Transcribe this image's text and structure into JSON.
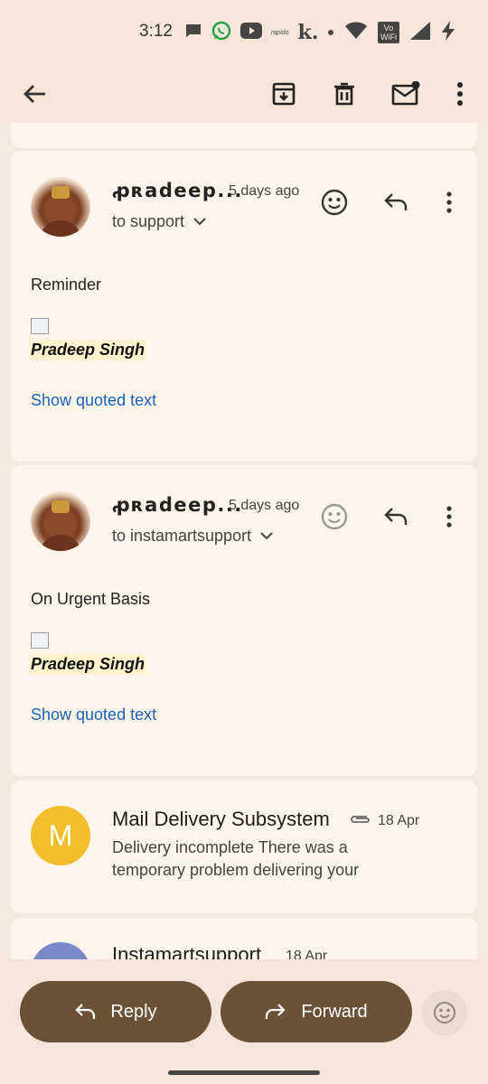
{
  "status_bar": {
    "time": "3:12",
    "icons": [
      "message-icon",
      "whatsapp-icon",
      "youtube-icon",
      "rapido-icon",
      "k-app-icon",
      "dot-icon",
      "wifi-icon",
      "vowifi-icon",
      "signal-icon",
      "charging-icon"
    ],
    "rapido_text": "rapido",
    "k_text": "k.",
    "vowifi_text": "Vo WiFi"
  },
  "toolbar": {
    "icons": [
      "back-arrow-icon",
      "archive-icon",
      "delete-icon",
      "mark-unread-icon",
      "more-vert-icon"
    ]
  },
  "messages": [
    {
      "sender": "ꝓʀadeep...",
      "time": "5 days ago",
      "recipient": "to support",
      "body": "Reminder",
      "signature": "Pradeep Singh",
      "show_quoted": "Show quoted text"
    },
    {
      "sender": "ꝓʀadeep...",
      "time": "5 days ago",
      "recipient": "to instamartsupport",
      "body": "On Urgent Basis",
      "signature": "Pradeep Singh",
      "show_quoted": "Show quoted text"
    }
  ],
  "collapsed": [
    {
      "avatar_letter": "M",
      "avatar_color": "#f2be2a",
      "sender": "Mail Delivery Subsystem",
      "date": "18 Apr",
      "snippet_line1": "Delivery incomplete There was a",
      "snippet_line2": "temporary problem delivering your"
    },
    {
      "avatar_color": "#7b89c9",
      "sender": "Instamartsupport",
      "date": "18 Apr"
    }
  ],
  "bottom_bar": {
    "reply_label": "Reply",
    "forward_label": "Forward"
  },
  "colors": {
    "background": "#f5e8dc",
    "card": "#fdf4ec",
    "action_pill": "#6b5237",
    "link": "#1a63b5"
  }
}
